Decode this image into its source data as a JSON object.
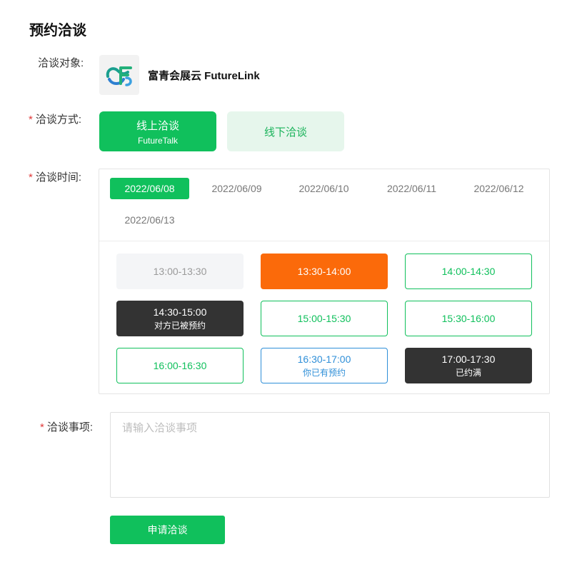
{
  "page": {
    "title": "预约洽谈"
  },
  "target": {
    "label": "洽谈对象:",
    "name": "富青会展云 FutureLink"
  },
  "mode": {
    "label": "洽谈方式:",
    "required": "*",
    "online": {
      "title": "线上洽谈",
      "subtitle": "FutureTalk"
    },
    "offline": {
      "title": "线下洽谈"
    }
  },
  "time": {
    "label": "洽谈时间:",
    "required": "*",
    "dates": [
      "2022/06/08",
      "2022/06/09",
      "2022/06/10",
      "2022/06/11",
      "2022/06/12",
      "2022/06/13"
    ],
    "selected_date": "2022/06/08",
    "slots": [
      {
        "time": "13:00-13:30",
        "note": "",
        "state": "disabled"
      },
      {
        "time": "13:30-14:00",
        "note": "",
        "state": "selected"
      },
      {
        "time": "14:00-14:30",
        "note": "",
        "state": "available"
      },
      {
        "time": "14:30-15:00",
        "note": "对方已被预约",
        "state": "booked-by-other"
      },
      {
        "time": "15:00-15:30",
        "note": "",
        "state": "available"
      },
      {
        "time": "15:30-16:00",
        "note": "",
        "state": "available"
      },
      {
        "time": "16:00-16:30",
        "note": "",
        "state": "available"
      },
      {
        "time": "16:30-17:00",
        "note": "你已有预约",
        "state": "booked-by-me"
      },
      {
        "time": "17:00-17:30",
        "note": "已约满",
        "state": "full"
      }
    ]
  },
  "topic": {
    "label": "洽谈事项:",
    "required": "*",
    "placeholder": "请输入洽谈事项",
    "value": ""
  },
  "submit": {
    "label": "申请洽谈"
  },
  "colors": {
    "primary": "#10c05c",
    "selected": "#fb6a0a",
    "dark": "#333333",
    "mine": "#2f8fd8",
    "required": "#e03a3a"
  }
}
